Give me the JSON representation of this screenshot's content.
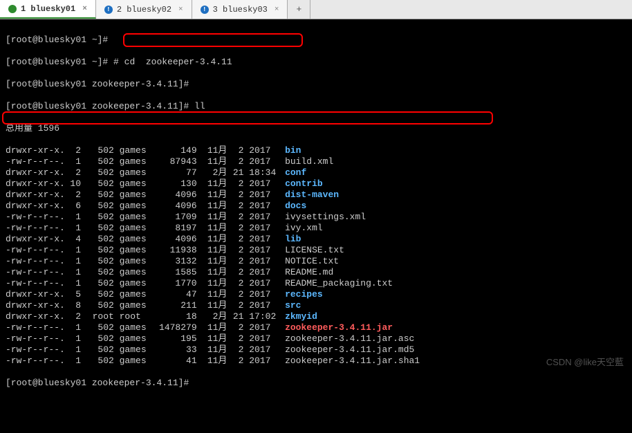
{
  "tabs": [
    {
      "label": "1 bluesky01",
      "active": true,
      "icon": "green"
    },
    {
      "label": "2 bluesky02",
      "active": false,
      "icon": "blue"
    },
    {
      "label": "3 bluesky03",
      "active": false,
      "icon": "blue"
    }
  ],
  "prompts": {
    "p1": "[root@bluesky01 ~]#",
    "p2": "[root@bluesky01 ~]#",
    "p3": "[root@bluesky01 zookeeper-3.4.11]#",
    "p4": "[root@bluesky01 zookeeper-3.4.11]#",
    "p5": "[root@bluesky01 zookeeper-3.4.11]#"
  },
  "commands": {
    "cd": " # cd  zookeeper-3.4.11",
    "ll": " ll"
  },
  "total_line": "总用量 1596",
  "listing": [
    {
      "perm": "drwxr-xr-x.",
      "links": "2",
      "owner": "502",
      "group": "games",
      "size": "149",
      "month": "11月",
      "day": "2",
      "time": "2017",
      "name": "bin",
      "type": "dir"
    },
    {
      "perm": "-rw-r--r--.",
      "links": "1",
      "owner": "502",
      "group": "games",
      "size": "87943",
      "month": "11月",
      "day": "2",
      "time": "2017",
      "name": "build.xml",
      "type": "plain"
    },
    {
      "perm": "drwxr-xr-x.",
      "links": "2",
      "owner": "502",
      "group": "games",
      "size": "77",
      "month": "2月",
      "day": "21",
      "time": "18:34",
      "name": "conf",
      "type": "dir"
    },
    {
      "perm": "drwxr-xr-x.",
      "links": "10",
      "owner": "502",
      "group": "games",
      "size": "130",
      "month": "11月",
      "day": "2",
      "time": "2017",
      "name": "contrib",
      "type": "dir"
    },
    {
      "perm": "drwxr-xr-x.",
      "links": "2",
      "owner": "502",
      "group": "games",
      "size": "4096",
      "month": "11月",
      "day": "2",
      "time": "2017",
      "name": "dist-maven",
      "type": "dir"
    },
    {
      "perm": "drwxr-xr-x.",
      "links": "6",
      "owner": "502",
      "group": "games",
      "size": "4096",
      "month": "11月",
      "day": "2",
      "time": "2017",
      "name": "docs",
      "type": "dir"
    },
    {
      "perm": "-rw-r--r--.",
      "links": "1",
      "owner": "502",
      "group": "games",
      "size": "1709",
      "month": "11月",
      "day": "2",
      "time": "2017",
      "name": "ivysettings.xml",
      "type": "plain"
    },
    {
      "perm": "-rw-r--r--.",
      "links": "1",
      "owner": "502",
      "group": "games",
      "size": "8197",
      "month": "11月",
      "day": "2",
      "time": "2017",
      "name": "ivy.xml",
      "type": "plain"
    },
    {
      "perm": "drwxr-xr-x.",
      "links": "4",
      "owner": "502",
      "group": "games",
      "size": "4096",
      "month": "11月",
      "day": "2",
      "time": "2017",
      "name": "lib",
      "type": "dir"
    },
    {
      "perm": "-rw-r--r--.",
      "links": "1",
      "owner": "502",
      "group": "games",
      "size": "11938",
      "month": "11月",
      "day": "2",
      "time": "2017",
      "name": "LICENSE.txt",
      "type": "plain"
    },
    {
      "perm": "-rw-r--r--.",
      "links": "1",
      "owner": "502",
      "group": "games",
      "size": "3132",
      "month": "11月",
      "day": "2",
      "time": "2017",
      "name": "NOTICE.txt",
      "type": "plain"
    },
    {
      "perm": "-rw-r--r--.",
      "links": "1",
      "owner": "502",
      "group": "games",
      "size": "1585",
      "month": "11月",
      "day": "2",
      "time": "2017",
      "name": "README.md",
      "type": "plain"
    },
    {
      "perm": "-rw-r--r--.",
      "links": "1",
      "owner": "502",
      "group": "games",
      "size": "1770",
      "month": "11月",
      "day": "2",
      "time": "2017",
      "name": "README_packaging.txt",
      "type": "plain"
    },
    {
      "perm": "drwxr-xr-x.",
      "links": "5",
      "owner": "502",
      "group": "games",
      "size": "47",
      "month": "11月",
      "day": "2",
      "time": "2017",
      "name": "recipes",
      "type": "dir"
    },
    {
      "perm": "drwxr-xr-x.",
      "links": "8",
      "owner": "502",
      "group": "games",
      "size": "211",
      "month": "11月",
      "day": "2",
      "time": "2017",
      "name": "src",
      "type": "dir"
    },
    {
      "perm": "drwxr-xr-x.",
      "links": "2",
      "owner": "root",
      "group": "root",
      "size": "18",
      "month": "2月",
      "day": "21",
      "time": "17:02",
      "name": "zkmyid",
      "type": "dir"
    },
    {
      "perm": "-rw-r--r--.",
      "links": "1",
      "owner": "502",
      "group": "games",
      "size": "1478279",
      "month": "11月",
      "day": "2",
      "time": "2017",
      "name": "zookeeper-3.4.11.jar",
      "type": "exe"
    },
    {
      "perm": "-rw-r--r--.",
      "links": "1",
      "owner": "502",
      "group": "games",
      "size": "195",
      "month": "11月",
      "day": "2",
      "time": "2017",
      "name": "zookeeper-3.4.11.jar.asc",
      "type": "plain"
    },
    {
      "perm": "-rw-r--r--.",
      "links": "1",
      "owner": "502",
      "group": "games",
      "size": "33",
      "month": "11月",
      "day": "2",
      "time": "2017",
      "name": "zookeeper-3.4.11.jar.md5",
      "type": "plain"
    },
    {
      "perm": "-rw-r--r--.",
      "links": "1",
      "owner": "502",
      "group": "games",
      "size": "41",
      "month": "11月",
      "day": "2",
      "time": "2017",
      "name": "zookeeper-3.4.11.jar.sha1",
      "type": "plain"
    }
  ],
  "watermark": "CSDN @like天空藍"
}
